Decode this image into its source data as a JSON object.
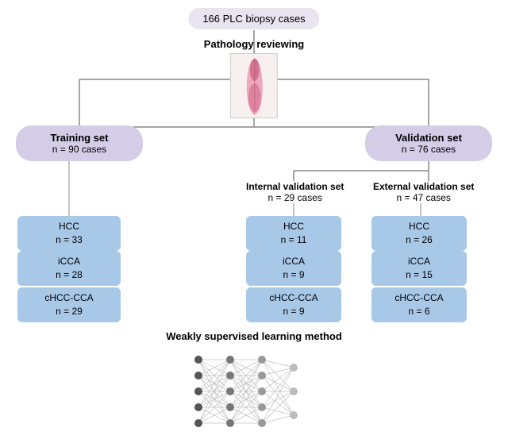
{
  "top": {
    "cases_label": "166 PLC biopsy cases"
  },
  "pathology": {
    "label": "Pathology reviewing"
  },
  "training": {
    "title": "Training set",
    "sub": "n = 90 cases",
    "hcc": {
      "line1": "HCC",
      "line2": "n = 33"
    },
    "icca": {
      "line1": "iCCA",
      "line2": "n = 28"
    },
    "chcc": {
      "line1": "cHCC-CCA",
      "line2": "n = 29"
    }
  },
  "validation": {
    "title": "Validation set",
    "sub": "n = 76 cases",
    "internal": {
      "title": "Internal validation set",
      "sub": "n = 29 cases",
      "hcc": {
        "line1": "HCC",
        "line2": "n = 11"
      },
      "icca": {
        "line1": "iCCA",
        "line2": "n = 9"
      },
      "chcc": {
        "line1": "cHCC-CCA",
        "line2": "n = 9"
      }
    },
    "external": {
      "title": "External validation set",
      "sub": "n = 47 cases",
      "hcc": {
        "line1": "HCC",
        "line2": "n = 26"
      },
      "icca": {
        "line1": "iCCA",
        "line2": "n = 15"
      },
      "chcc": {
        "line1": "cHCC-CCA",
        "line2": "n = 6"
      }
    }
  },
  "nn": {
    "label": "Weakly supervised learning method"
  }
}
